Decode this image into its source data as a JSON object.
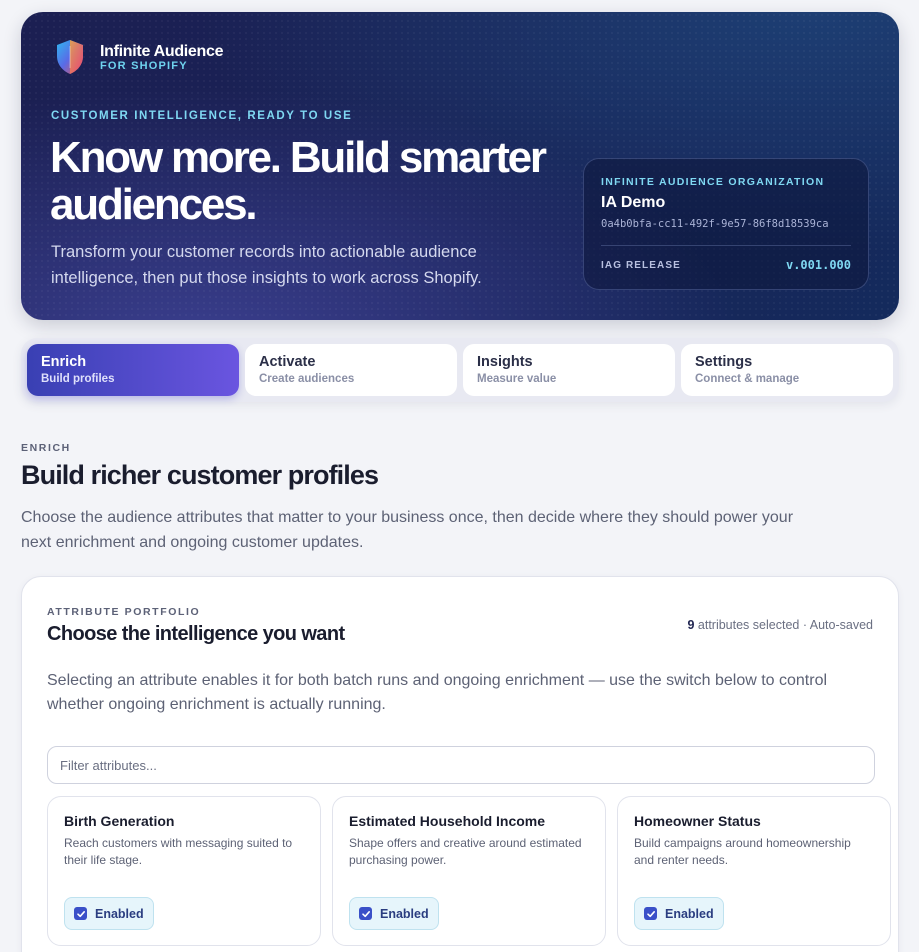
{
  "brand": {
    "name": "Infinite Audience",
    "sub": "FOR SHOPIFY"
  },
  "hero": {
    "eyebrow": "CUSTOMER INTELLIGENCE, READY TO USE",
    "title": "Know more. Build smarter audiences.",
    "description": "Transform your customer records into actionable audience intelligence, then put those insights to work across Shopify."
  },
  "org": {
    "label": "INFINITE AUDIENCE ORGANIZATION",
    "name": "IA Demo",
    "id": "0a4b0bfa-cc11-492f-9e57-86f8d18539ca",
    "release_label": "IAG RELEASE",
    "release": "v.001.000"
  },
  "tabs": [
    {
      "title": "Enrich",
      "sub": "Build profiles",
      "active": true
    },
    {
      "title": "Activate",
      "sub": "Create audiences",
      "active": false
    },
    {
      "title": "Insights",
      "sub": "Measure value",
      "active": false
    },
    {
      "title": "Settings",
      "sub": "Connect & manage",
      "active": false
    }
  ],
  "section": {
    "eyebrow": "ENRICH",
    "title": "Build richer customer profiles",
    "description": "Choose the audience attributes that matter to your business once, then decide where they should power your next enrichment and ongoing customer updates."
  },
  "panel": {
    "eyebrow": "ATTRIBUTE PORTFOLIO",
    "title": "Choose the intelligence you want",
    "selected_count": "9",
    "selected_text": " attributes selected · Auto-saved",
    "description": "Selecting an attribute enables it for both batch runs and ongoing enrichment — use the switch below to control whether ongoing enrichment is actually running.",
    "filter_placeholder": "Filter attributes..."
  },
  "attributes": [
    {
      "title": "Birth Generation",
      "description": "Reach customers with messaging suited to their life stage.",
      "status": "Enabled"
    },
    {
      "title": "Estimated Household Income",
      "description": "Shape offers and creative around estimated purchasing power.",
      "status": "Enabled"
    },
    {
      "title": "Homeowner Status",
      "description": "Build campaigns around homeownership and renter needs.",
      "status": "Enabled"
    }
  ],
  "colors": {
    "accent": "#3a50c8",
    "hero_bg": "#1b1f52",
    "cyan": "#7fd8f2"
  },
  "icons": {
    "logo": "shield-logo-icon",
    "check": "checkmark-icon"
  }
}
